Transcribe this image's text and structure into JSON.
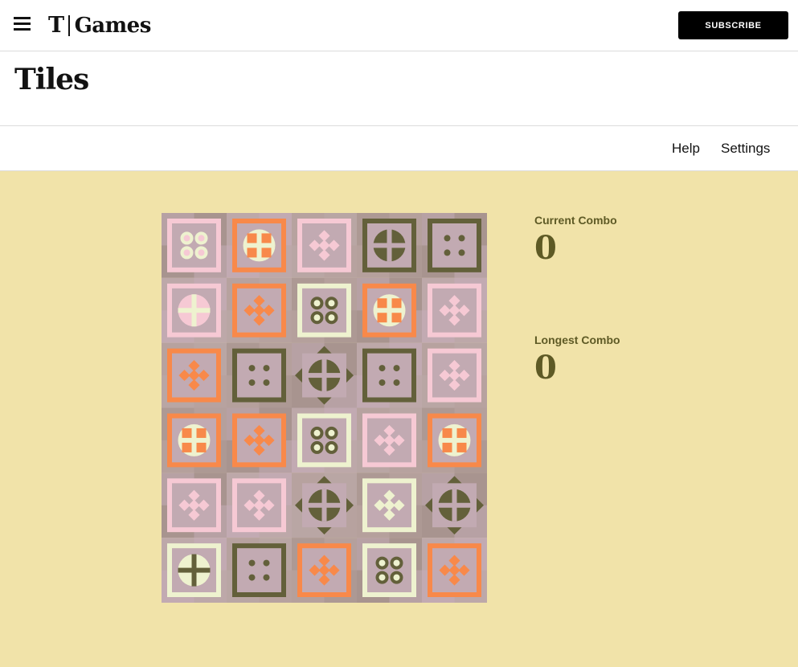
{
  "header": {
    "brand_mark": "T",
    "brand_name": "Games",
    "subscribe_label": "SUBSCRIBE"
  },
  "page": {
    "title": "Tiles"
  },
  "toolbar": {
    "help_label": "Help",
    "settings_label": "Settings"
  },
  "stats": {
    "current_combo_label": "Current Combo",
    "current_combo_value": "0",
    "longest_combo_label": "Longest Combo",
    "longest_combo_value": "0"
  },
  "colors": {
    "page_bg": "#f1e3a9",
    "olive": "#5e5a25",
    "orange": "#f8894a",
    "pink": "#f6c9d4",
    "mauve": "#c2aab2",
    "taupe": "#a8948f",
    "cream": "#eef2cf",
    "dark_olive": "#63603a"
  },
  "board": {
    "rows": 6,
    "cols": 5,
    "tiles": [
      [
        "pink-rings",
        "orange-quatrefoil",
        "pink-diamonds",
        "olive-cross",
        "olive-rings"
      ],
      [
        "pink-cross",
        "orange-diamonds",
        "cream-rings",
        "orange-quatrefoil",
        "pink-diamonds"
      ],
      [
        "orange-diamonds",
        "olive-rings",
        "olive-cross",
        "olive-rings",
        "pink-diamonds"
      ],
      [
        "orange-quatrefoil",
        "orange-diamonds",
        "cream-rings",
        "pink-diamonds",
        "orange-quatrefoil"
      ],
      [
        "pink-diamonds",
        "pink-diamonds",
        "olive-cross",
        "cream-diamonds",
        "olive-cross"
      ],
      [
        "cream-cross",
        "olive-rings",
        "orange-diamonds",
        "cream-rings",
        "orange-diamonds"
      ]
    ]
  }
}
